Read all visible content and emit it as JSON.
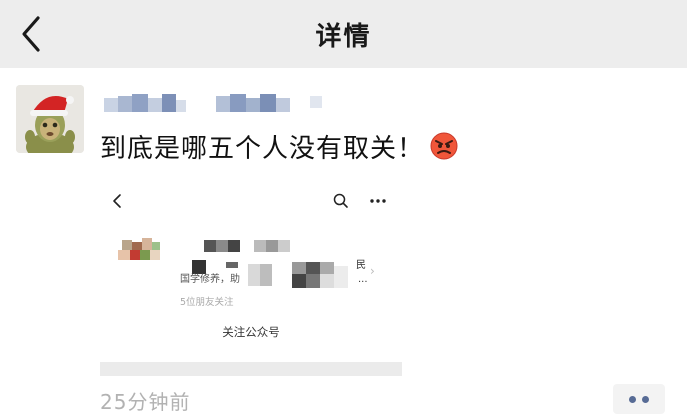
{
  "header": {
    "title": "详情",
    "back_icon": "chevron-left-icon"
  },
  "post": {
    "avatar_icon": "santa-hat-avatar-icon",
    "text": "到底是哪五个人没有取关！",
    "emoji_icon": "angry-face-emoji-icon",
    "time": "25分钟前"
  },
  "embed": {
    "back_icon": "chevron-left-icon",
    "search_icon": "search-icon",
    "more_icon": "more-dots-icon",
    "trailing_char": "民",
    "ellipsis": "...",
    "description": "国学修养，助",
    "followers": "5位朋友关注",
    "action_label": "关注公众号"
  },
  "actions": {
    "more_icon": "more-dots-icon"
  },
  "colors": {
    "header_bg": "#ededed",
    "link_blue": "#576b95",
    "time_grey": "#b2b2b2"
  }
}
